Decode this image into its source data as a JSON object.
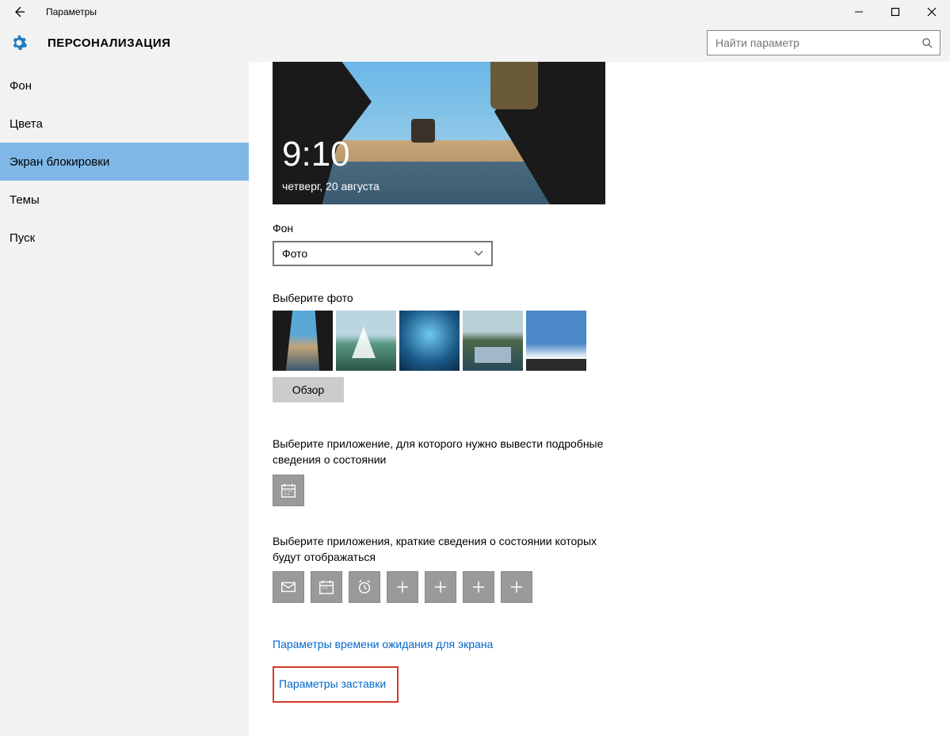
{
  "titlebar": {
    "app_title": "Параметры"
  },
  "header": {
    "page_title": "ПЕРСОНАЛИЗАЦИЯ"
  },
  "search": {
    "placeholder": "Найти параметр"
  },
  "sidebar": {
    "items": [
      {
        "label": "Фон",
        "active": false
      },
      {
        "label": "Цвета",
        "active": false
      },
      {
        "label": "Экран блокировки",
        "active": true
      },
      {
        "label": "Темы",
        "active": false
      },
      {
        "label": "Пуск",
        "active": false
      }
    ]
  },
  "preview": {
    "time": "9:10",
    "date": "четверг, 20 августа"
  },
  "main": {
    "background_label": "Фон",
    "background_select_value": "Фото",
    "choose_photo_label": "Выберите фото",
    "browse_label": "Обзор",
    "detailed_app_label": "Выберите приложение, для которого нужно вывести подробные сведения о состоянии",
    "quick_apps_label": "Выберите приложения, краткие сведения о состоянии которых будут отображаться",
    "timeout_link": "Параметры времени ожидания для экрана",
    "screensaver_link": "Параметры заставки"
  }
}
